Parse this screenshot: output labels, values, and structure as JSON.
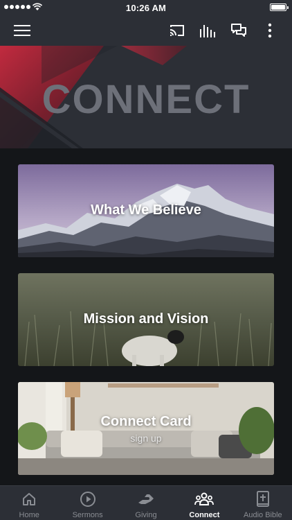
{
  "status_bar": {
    "time": "10:26 AM"
  },
  "top_nav": {
    "icons": [
      "menu-icon",
      "cast-icon",
      "audio-bars-icon",
      "chat-icon",
      "more-vertical-icon"
    ]
  },
  "hero": {
    "title": "CONNECT",
    "accent_color": "#c92a3f"
  },
  "cards": [
    {
      "title": "What We Believe",
      "subtitle": "",
      "image": "snowy-mountain"
    },
    {
      "title": "Mission and Vision",
      "subtitle": "",
      "image": "lamb-in-field"
    },
    {
      "title": "Connect Card",
      "subtitle": "sign up",
      "image": "living-room"
    }
  ],
  "tab_bar": {
    "active": "Connect",
    "tabs": [
      {
        "label": "Home",
        "icon": "home-icon"
      },
      {
        "label": "Sermons",
        "icon": "play-circle-icon"
      },
      {
        "label": "Giving",
        "icon": "giving-hand-icon"
      },
      {
        "label": "Connect",
        "icon": "people-icon"
      },
      {
        "label": "Audio Bible",
        "icon": "bible-icon"
      }
    ]
  },
  "colors": {
    "bar_background": "#2c2f36",
    "page_background": "#141619",
    "inactive_tab": "#8a8d93",
    "active_tab": "#ffffff"
  }
}
